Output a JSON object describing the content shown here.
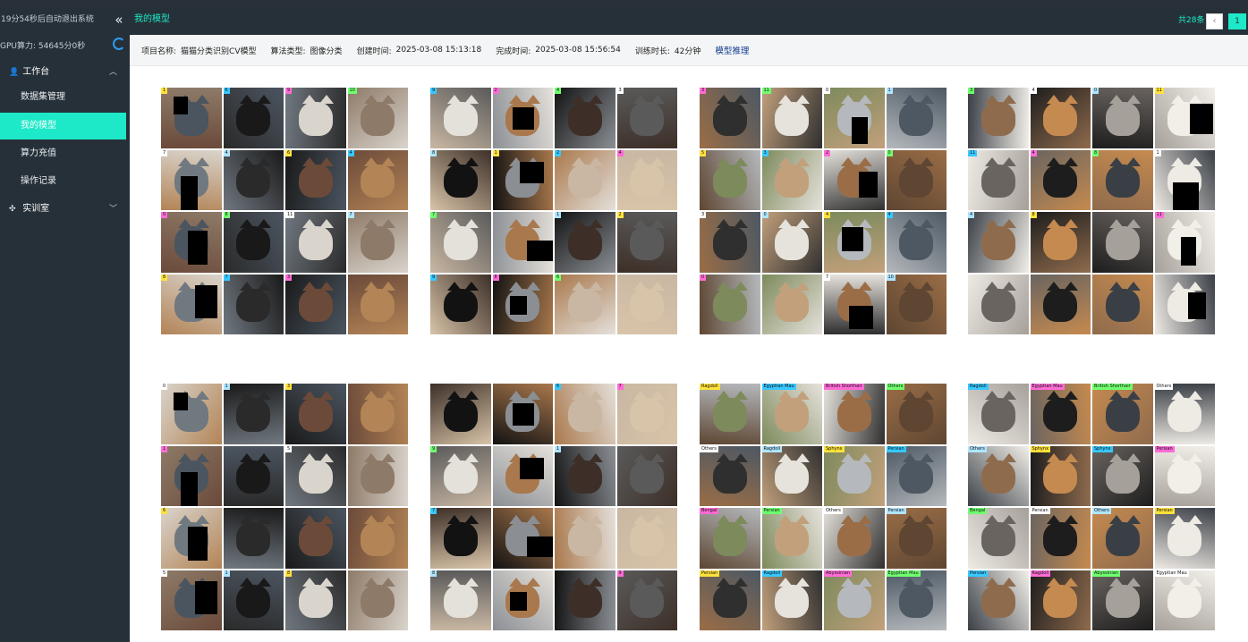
{
  "sidebar": {
    "timer": "19分54秒后自动退出系统",
    "gpu": "GPU算力: 54645分0秒",
    "groups": [
      {
        "label": "工作台",
        "icon": "user-icon"
      },
      {
        "label": "实训室",
        "icon": "puzzle-icon"
      }
    ],
    "items": [
      {
        "label": "数据集管理"
      },
      {
        "label": "我的模型"
      },
      {
        "label": "算力充值"
      },
      {
        "label": "操作记录"
      }
    ]
  },
  "header": {
    "title": "我的模型",
    "count": "共28条",
    "prev": "‹",
    "page": "1"
  },
  "info": {
    "project_label": "项目名称:",
    "project_value": "猫猫分类识别CV模型",
    "algo_label": "算法类型:",
    "algo_value": "图像分类",
    "created_label": "创建时间:",
    "created_value": "2025-03-08 15:13:18",
    "finished_label": "完成时间:",
    "finished_value": "2025-03-08 15:56:54",
    "duration_label": "训练时长:",
    "duration_value": "42分钟",
    "infer_link": "模型推理"
  },
  "batches": [
    {
      "labels": [
        "1",
        "6",
        "9",
        "10",
        "7",
        "4",
        "6",
        "4",
        "0",
        "8",
        "11",
        "7",
        "8",
        "7",
        "3",
        ""
      ]
    },
    {
      "labels": [
        "9",
        "2",
        "4",
        "3",
        "8",
        "1",
        "2",
        "4",
        "7",
        "",
        "1",
        "2",
        "9",
        "8",
        "6",
        ""
      ]
    },
    {
      "labels": [
        "3",
        "11",
        "0",
        "1",
        "5",
        "3",
        "2",
        "0",
        "3",
        "0",
        "4",
        "4",
        "0",
        "",
        "7",
        "10"
      ]
    },
    {
      "labels": [
        "3",
        "4",
        "0",
        "11",
        "11",
        "4",
        "8",
        "1",
        "4",
        "8",
        "",
        "11",
        "",
        "",
        "",
        ""
      ]
    },
    {
      "labels": [
        "0",
        "1",
        "3",
        "",
        "1",
        "",
        "5",
        "",
        "6",
        "",
        "",
        "",
        "5",
        "1",
        "8",
        ""
      ]
    },
    {
      "labels": [
        "",
        "",
        "6",
        "7",
        "9",
        "",
        "1",
        "",
        "7",
        "",
        "",
        "",
        "8",
        "",
        "",
        "9"
      ]
    },
    {
      "labels": [
        "Ragdoll",
        "Egyptian Mau",
        "British Shorthair",
        "Others",
        "Others",
        "Ragdoll",
        "Sphynx",
        "Persian",
        "Bengal",
        "Persian",
        "Others",
        "Persian",
        "Persian",
        "Ragdoll",
        "Abyssinian",
        "Egyptian Mau"
      ]
    },
    {
      "labels": [
        "Ragdoll",
        "Egyptian Mau",
        "British Shorthair",
        "Others",
        "Others",
        "Sphynx",
        "Sphynx",
        "Persian",
        "Bengal",
        "Persian",
        "Others",
        "Persian",
        "Persian",
        "Ragdoll",
        "Abyssinian",
        "Egyptian Mau"
      ]
    }
  ],
  "colors": {
    "accent": "#1de9c8",
    "sidebar_bg": "#263038",
    "link": "#0b3a8e"
  }
}
